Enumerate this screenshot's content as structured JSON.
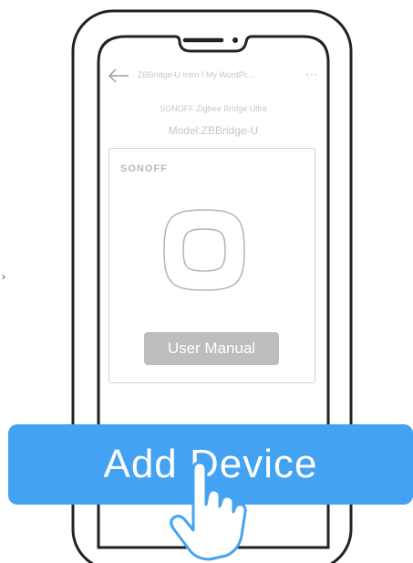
{
  "screen": {
    "page_title": "ZBBridge-U Intro I My WordPr...",
    "more_icon": "⋯",
    "product_name": "SONOFF Zigbee Bridge Ultra",
    "model": "Model:ZBBridge-U"
  },
  "card": {
    "brand": "SONOFF",
    "user_manual_label": "User Manual"
  },
  "cta": {
    "label": "Add Device"
  },
  "icons": {
    "back": "back-arrow-icon",
    "more": "more-icon",
    "pointer": "hand-pointer-icon",
    "side": "chevron-right-icon"
  },
  "colors": {
    "primary_blue": "#44a2f3",
    "manual_button_gray": "#bdbdbd",
    "outline": "#222222"
  }
}
